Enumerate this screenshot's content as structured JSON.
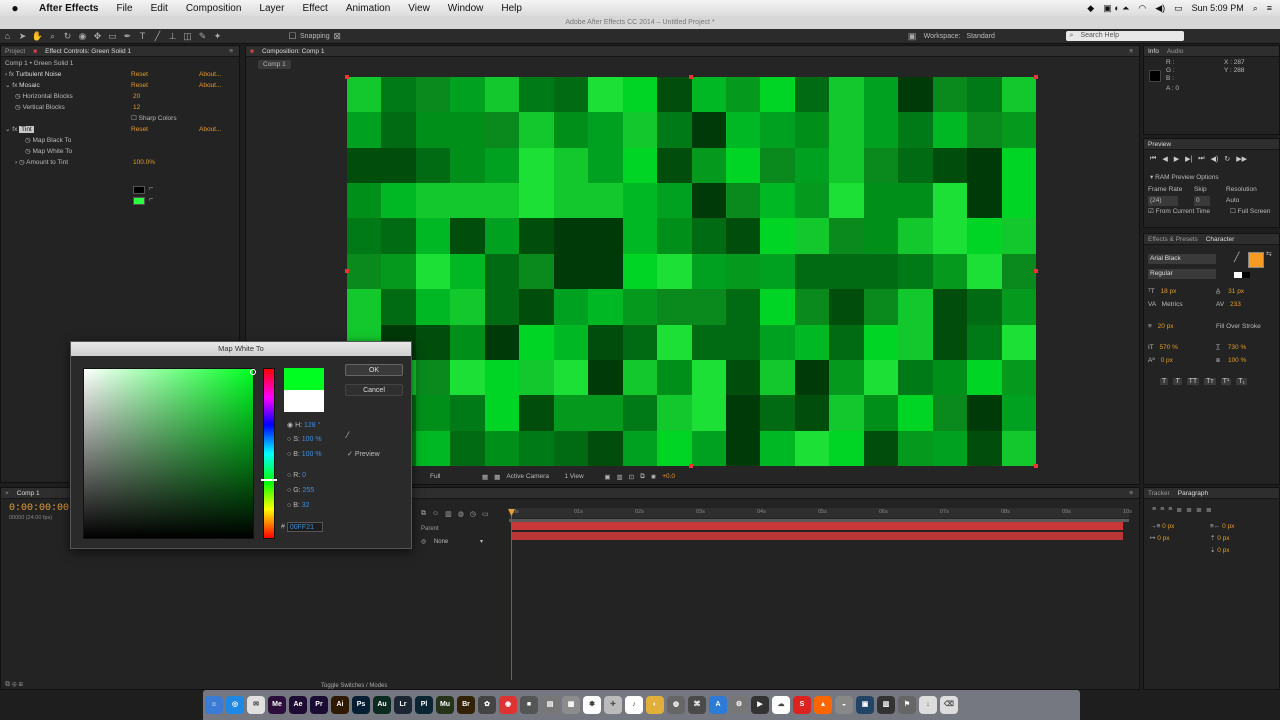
{
  "menubar": {
    "app": "After Effects",
    "items": [
      "File",
      "Edit",
      "Composition",
      "Layer",
      "Effect",
      "Animation",
      "View",
      "Window",
      "Help"
    ],
    "clock": "Sun 5:09 PM"
  },
  "window_title": "Adobe After Effects CC 2014 – Untitled Project *",
  "toolbar": {
    "snapping": "Snapping",
    "workspace_label": "Workspace:",
    "workspace_value": "Standard",
    "search": "Search Help"
  },
  "effect_controls": {
    "tab_project": "Project",
    "tab_effect": "Effect Controls: Green Solid 1",
    "subtitle": "Comp 1 • Green Solid 1",
    "rows": [
      {
        "name": "Turbulent Noise",
        "value": "Reset",
        "about": "About..."
      },
      {
        "name": "Mosaic",
        "value": "Reset",
        "about": "About..."
      },
      {
        "name": "Horizontal Blocks",
        "value": "20",
        "about": ""
      },
      {
        "name": "Vertical Blocks",
        "value": "12",
        "about": ""
      },
      {
        "name": "Sharp Colors",
        "value": "",
        "about": ""
      },
      {
        "name": "Tint",
        "value": "Reset",
        "about": "About..."
      },
      {
        "name": "Map Black To",
        "value": "",
        "about": ""
      },
      {
        "name": "Map White To",
        "value": "",
        "about": ""
      },
      {
        "name": "Amount to Tint",
        "value": "100.0%",
        "about": ""
      }
    ]
  },
  "composition": {
    "tab": "Composition: Comp 1",
    "breadcrumb": "Comp 1",
    "footer": {
      "resolution": "Full",
      "camera": "Active Camera",
      "views": "1 View",
      "exposure": "+0.0"
    }
  },
  "dialog": {
    "title": "Map White To",
    "ok": "OK",
    "cancel": "Cancel",
    "preview": "Preview",
    "h_label": "H:",
    "h_value": "128 °",
    "s_label": "S:",
    "s_value": "100 %",
    "b_label": "B:",
    "b_value": "100 %",
    "r_label": "R:",
    "r_value": "0",
    "g_label": "G:",
    "g_value": "255",
    "bb_label": "B:",
    "bb_value": "32",
    "hex_label": "#",
    "hex_value": "00FF21",
    "new_color": "#00ff21",
    "old_color": "#ffffff"
  },
  "info": {
    "tab_info": "Info",
    "tab_audio": "Audio",
    "r": "R :",
    "g": "G :",
    "b": "B :",
    "a": "A : 0",
    "x": "X : 287",
    "y": "Y : 288"
  },
  "preview": {
    "tab": "Preview",
    "options": "RAM Preview Options",
    "frame_rate_label": "Frame Rate",
    "skip_label": "Skip",
    "resolution_label": "Resolution",
    "frame_rate": "(24)",
    "skip": "0",
    "resolution": "Auto",
    "from_current": "From Current Time",
    "full_screen": "Full Screen"
  },
  "character": {
    "tab_effects": "Effects & Presets",
    "tab_char": "Character",
    "font": "Arial Black",
    "style": "Regular",
    "size": "18 px",
    "leading": "31 px",
    "kerning": "Metrics",
    "tracking": "233",
    "stroke": "20 px",
    "stroke_mode": "Fill Over Stroke",
    "vscale": "570 %",
    "hscale": "730 %",
    "baseline": "0 px",
    "tsume": "100 %",
    "fill_color": "#f59a23"
  },
  "timeline": {
    "tab": "Comp 1",
    "time": "0:00:00:00",
    "fps": "00000 (24.00 fps)",
    "parent_label": "Parent",
    "parent_value": "None",
    "ruler": [
      "0s",
      "01s",
      "02s",
      "03s",
      "04s",
      "05s",
      "06s",
      "07s",
      "08s",
      "09s",
      "10s"
    ],
    "toggle": "Toggle Switches / Modes"
  },
  "paragraph": {
    "tab_tracker": "Tracker",
    "tab_para": "Paragraph",
    "values": [
      "0 px",
      "0 px",
      "0 px",
      "0 px",
      "0 px"
    ]
  },
  "dock_icons": [
    {
      "name": "finder-icon",
      "color": "#3a7bd5",
      "glyph": "☺"
    },
    {
      "name": "safari-icon",
      "color": "#1e88e5",
      "glyph": "◎"
    },
    {
      "name": "mail-icon",
      "color": "#e0e0e0",
      "glyph": "✉"
    },
    {
      "name": "media-encoder-icon",
      "color": "#2b0f3a",
      "glyph": "Me"
    },
    {
      "name": "after-effects-icon",
      "color": "#1d0b33",
      "glyph": "Ae"
    },
    {
      "name": "premiere-icon",
      "color": "#1a0b33",
      "glyph": "Pr"
    },
    {
      "name": "illustrator-icon",
      "color": "#2e1a00",
      "glyph": "Ai"
    },
    {
      "name": "photoshop-icon",
      "color": "#061e33",
      "glyph": "Ps"
    },
    {
      "name": "audition-icon",
      "color": "#0b2b20",
      "glyph": "Au"
    },
    {
      "name": "lightroom-icon",
      "color": "#1c2733",
      "glyph": "Lr"
    },
    {
      "name": "prelude-icon",
      "color": "#0b2533",
      "glyph": "Pl"
    },
    {
      "name": "muse-icon",
      "color": "#25331b",
      "glyph": "Mu"
    },
    {
      "name": "bridge-icon",
      "color": "#332106",
      "glyph": "Br"
    },
    {
      "name": "resolve-icon",
      "color": "#444",
      "glyph": "✿"
    },
    {
      "name": "app-icon",
      "color": "#d33",
      "glyph": "◉"
    },
    {
      "name": "app-icon",
      "color": "#555",
      "glyph": "■"
    },
    {
      "name": "app-icon",
      "color": "#777",
      "glyph": "▤"
    },
    {
      "name": "app-icon",
      "color": "#8c8c8c",
      "glyph": "▦"
    },
    {
      "name": "photos-icon",
      "color": "#fff",
      "glyph": "✽"
    },
    {
      "name": "app-icon",
      "color": "#bbb",
      "glyph": "✈"
    },
    {
      "name": "app-icon",
      "color": "#fff",
      "glyph": "♪"
    },
    {
      "name": "app-icon",
      "color": "#e2b03a",
      "glyph": "◐"
    },
    {
      "name": "app-icon",
      "color": "#666",
      "glyph": "◍"
    },
    {
      "name": "app-icon",
      "color": "#4a4a4a",
      "glyph": "⌘"
    },
    {
      "name": "app-icon",
      "color": "#2d7bd6",
      "glyph": "A"
    },
    {
      "name": "app-icon",
      "color": "#777",
      "glyph": "⚙"
    },
    {
      "name": "app-icon",
      "color": "#333",
      "glyph": "▶"
    },
    {
      "name": "app-icon",
      "color": "#fff",
      "glyph": "☁"
    },
    {
      "name": "app-icon",
      "color": "#d22",
      "glyph": "S"
    },
    {
      "name": "vlc-icon",
      "color": "#f60",
      "glyph": "▲"
    },
    {
      "name": "app-icon",
      "color": "#888",
      "glyph": "◒"
    },
    {
      "name": "app-icon",
      "color": "#246",
      "glyph": "▣"
    },
    {
      "name": "app-icon",
      "color": "#333",
      "glyph": "▥"
    },
    {
      "name": "app-icon",
      "color": "#666",
      "glyph": "⚑"
    },
    {
      "name": "downloads-icon",
      "color": "#ddd",
      "glyph": "↓"
    },
    {
      "name": "trash-icon",
      "color": "#ddd",
      "glyph": "⌫"
    }
  ]
}
